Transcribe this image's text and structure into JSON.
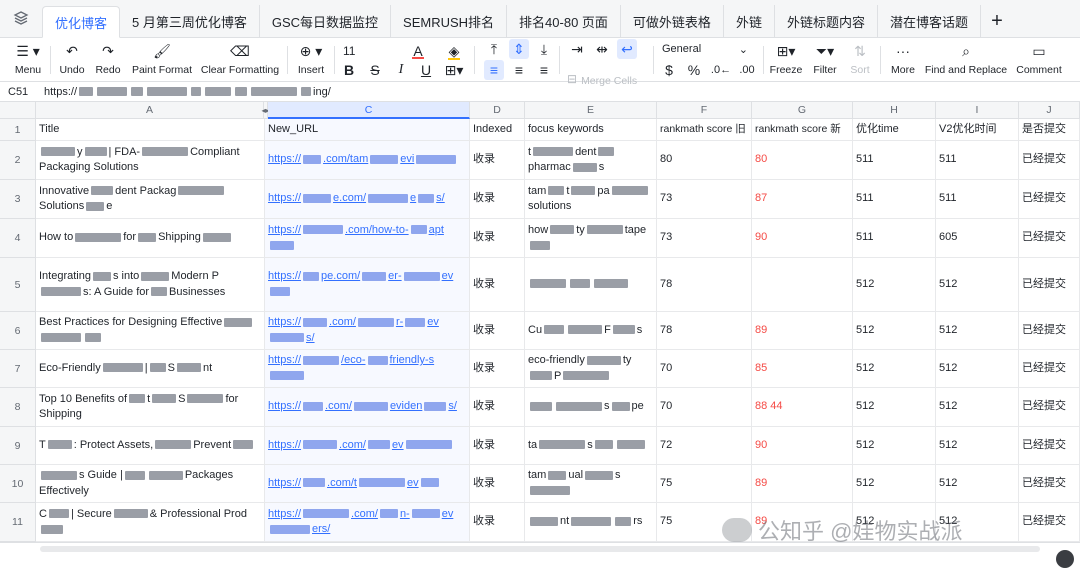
{
  "tabs": {
    "items": [
      {
        "label": "优化博客",
        "active": true
      },
      {
        "label": "5 月第三周优化博客"
      },
      {
        "label": "GSC每日数据监控"
      },
      {
        "label": "SEMRUSH排名"
      },
      {
        "label": "排名40-80 页面"
      },
      {
        "label": "可做外链表格"
      },
      {
        "label": "外链"
      },
      {
        "label": "外链标题内容"
      },
      {
        "label": "潜在博客话题"
      }
    ],
    "add": "+"
  },
  "toolbar": {
    "menu": "Menu",
    "undo": "Undo",
    "redo": "Redo",
    "paint_format": "Paint Format",
    "clear_formatting": "Clear Formatting",
    "insert": "Insert",
    "font_size": "11",
    "number_format": "General",
    "merge_cells": "Merge Cells",
    "freeze": "Freeze",
    "filter": "Filter",
    "sort": "Sort",
    "more": "More",
    "find_replace": "Find and Replace",
    "comment": "Comment",
    "currency": "$",
    "percent": "%"
  },
  "formula": {
    "cell_ref": "C51",
    "value_prefix": "https://",
    "value_suffix": "ing/"
  },
  "columns": [
    "A",
    "B",
    "C",
    "D",
    "E",
    "F",
    "G",
    "H",
    "I",
    "J"
  ],
  "headers": {
    "title": "Title",
    "new_url": "New_URL",
    "indexed": "Indexed",
    "focus": "focus keywords",
    "score_old": "rankmath score 旧",
    "score_new": "rankmath score 新",
    "opt_time": "优化time",
    "v2_time": "V2优化时间",
    "submitted": "是否提交"
  },
  "rows": [
    {
      "num": "2",
      "title": [
        "",
        "y",
        "| FDA-",
        "Compliant Packaging Solutions"
      ],
      "url": [
        "https://",
        ".com/tam",
        "evi",
        ""
      ],
      "indexed": "收录",
      "focus": [
        "t",
        "dent",
        "pharmac",
        "s"
      ],
      "score_old": "80",
      "score_new": "80",
      "opt_time": "511",
      "v2_time": "511",
      "submitted": "已经提交"
    },
    {
      "num": "3",
      "title": [
        "Innovative",
        "dent Packag",
        "Solutions",
        "e"
      ],
      "url": [
        "https://",
        "e.com/",
        "e",
        "s/"
      ],
      "indexed": "收录",
      "focus": [
        "tam",
        "t",
        "pa",
        "solutions"
      ],
      "score_old": "73",
      "score_new": "87",
      "opt_time": "511",
      "v2_time": "511",
      "submitted": "已经提交"
    },
    {
      "num": "4",
      "title": [
        "How to",
        "for",
        "Shipping",
        ""
      ],
      "url": [
        "https://",
        ".com/how-to-",
        "apt",
        ""
      ],
      "indexed": "收录",
      "focus": [
        "how",
        "ty",
        "tape",
        ""
      ],
      "score_old": "73",
      "score_new": "90",
      "opt_time": "511",
      "v2_time": "605",
      "submitted": "已经提交"
    },
    {
      "num": "5",
      "title": [
        "Integrating",
        "s into",
        "Modern P",
        "s: A Guide for",
        "Businesses"
      ],
      "url": [
        "https://",
        "pe.com/",
        "er-",
        "ev",
        ""
      ],
      "indexed": "收录",
      "focus": [
        "",
        "",
        "",
        ""
      ],
      "score_old": "78",
      "score_new": "",
      "opt_time": "512",
      "v2_time": "512",
      "submitted": "已经提交"
    },
    {
      "num": "6",
      "title": [
        "Best Practices for Designing Effective",
        "",
        "",
        ""
      ],
      "url": [
        "https://",
        ".com/",
        "r-",
        "ev",
        "s/"
      ],
      "indexed": "收录",
      "focus": [
        "Cu",
        "",
        "F",
        "s"
      ],
      "score_old": "78",
      "score_new": "89",
      "opt_time": "512",
      "v2_time": "512",
      "submitted": "已经提交"
    },
    {
      "num": "7",
      "title": [
        "Eco-Friendly",
        "|",
        "S",
        "nt"
      ],
      "url": [
        "https://",
        "/eco-",
        "friendly-s",
        ""
      ],
      "indexed": "收录",
      "focus": [
        "eco-friendly",
        "ty",
        "P",
        ""
      ],
      "score_old": "70",
      "score_new": "85",
      "opt_time": "512",
      "v2_time": "512",
      "submitted": "已经提交"
    },
    {
      "num": "8",
      "title": [
        "Top 10 Benefits of",
        "t",
        "S",
        "for Shipping"
      ],
      "url": [
        "https://",
        ".com/",
        "eviden",
        "s/"
      ],
      "indexed": "收录",
      "focus": [
        "",
        "",
        "s",
        "pe"
      ],
      "score_old": "70",
      "score_new": "88 44",
      "opt_time": "512",
      "v2_time": "512",
      "submitted": "已经提交"
    },
    {
      "num": "9",
      "title": [
        "T",
        ": Protect Assets,",
        "Prevent",
        ""
      ],
      "url": [
        "https://",
        ".com/",
        "ev",
        ""
      ],
      "indexed": "收录",
      "focus": [
        "ta",
        "s",
        "",
        ""
      ],
      "score_old": "72",
      "score_new": "90",
      "opt_time": "512",
      "v2_time": "512",
      "submitted": "已经提交"
    },
    {
      "num": "10",
      "title": [
        "",
        "s Guide |",
        "",
        "Packages Effectively"
      ],
      "url": [
        "https://",
        ".com/t",
        "ev",
        ""
      ],
      "indexed": "收录",
      "focus": [
        "tam",
        "ual",
        "s",
        ""
      ],
      "score_old": "75",
      "score_new": "89",
      "opt_time": "512",
      "v2_time": "512",
      "submitted": "已经提交"
    },
    {
      "num": "11",
      "title": [
        "C",
        "| Secure",
        "& Professional Prod",
        ""
      ],
      "url": [
        "https://",
        ".com/",
        "n-",
        "ev",
        "ers/"
      ],
      "indexed": "收录",
      "focus": [
        "",
        "nt",
        "",
        "rs"
      ],
      "score_old": "75",
      "score_new": "89",
      "opt_time": "512",
      "v2_time": "512",
      "submitted": "已经提交"
    }
  ],
  "watermark": "公知乎 @娃物实战派",
  "colors": {
    "accent": "#3370ff",
    "red": "#f54a45",
    "header_bg": "#f5f6f7",
    "border": "#dee0e3"
  }
}
